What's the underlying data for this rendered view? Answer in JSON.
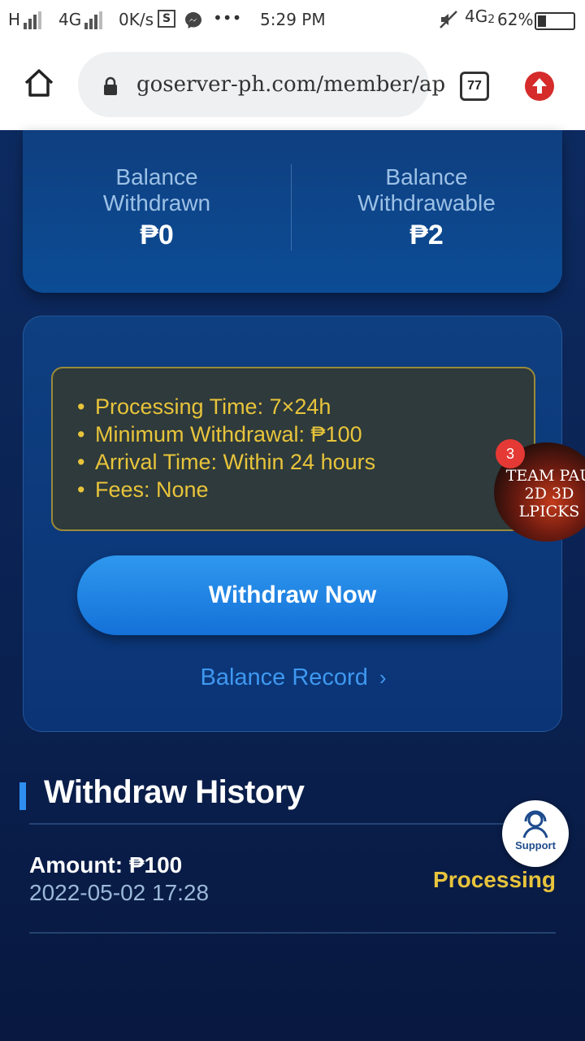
{
  "status_bar": {
    "net1": "H",
    "net2": "4G",
    "speed": "0K/s",
    "s_icon": "S",
    "more": "•••",
    "time": "5:29 PM",
    "net3": "4G",
    "net3_sub": "2",
    "battery": "62%"
  },
  "browser": {
    "url": "goserver-ph.com/member/ap",
    "tab_count": "77",
    "icons": [
      "home-icon",
      "lock-icon",
      "tabs-icon",
      "update-icon"
    ]
  },
  "balances": [
    {
      "label_line1": "Balance",
      "label_line2": "Withdrawn",
      "value": "₱0"
    },
    {
      "label_line1": "Balance",
      "label_line2": "Withdrawable",
      "value": "₱2"
    }
  ],
  "withdraw_info": [
    "Processing Time: 7×24h",
    "Minimum Withdrawal: ₱100",
    "Arrival Time: Within 24 hours",
    "Fees: None"
  ],
  "withdraw_button": "Withdraw Now",
  "balance_record": "Balance Record",
  "history": {
    "title": "Withdraw History",
    "items": [
      {
        "amount": "Amount: ₱100",
        "date": "2022-05-02 17:28",
        "status": "Processing"
      }
    ]
  },
  "promo": {
    "badge": "3",
    "line1": "TEAM PAU",
    "line2": "2D 3D",
    "line3": "LPICKS"
  },
  "support": {
    "label": "Support"
  },
  "colors": {
    "page_bg": "#0c2354",
    "card": "#0e3f80",
    "accent": "#2f8ff0",
    "gold": "#e8c43b",
    "button": "#1f84e6"
  }
}
